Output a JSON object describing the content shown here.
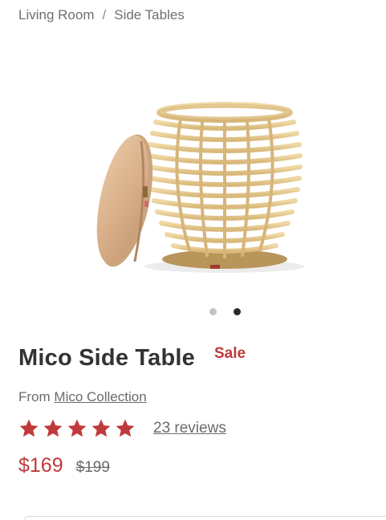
{
  "breadcrumb": {
    "items": [
      {
        "label": "Living Room"
      },
      {
        "label": "Side Tables"
      }
    ],
    "separator": "/"
  },
  "gallery": {
    "image_alt": "Mico Side Table rattan stool with round wooden lid",
    "pages": 2,
    "current_page": 2
  },
  "product": {
    "title": "Mico Side Table",
    "badge": "Sale",
    "from_prefix": "From",
    "collection_link": "Mico Collection",
    "rating": 5,
    "rating_max": 5,
    "reviews_label": "23 reviews",
    "price": "$169",
    "original_price": "$199"
  },
  "colors": {
    "accent": "#c0393b",
    "text": "#333333",
    "muted": "#6b6b6b"
  }
}
